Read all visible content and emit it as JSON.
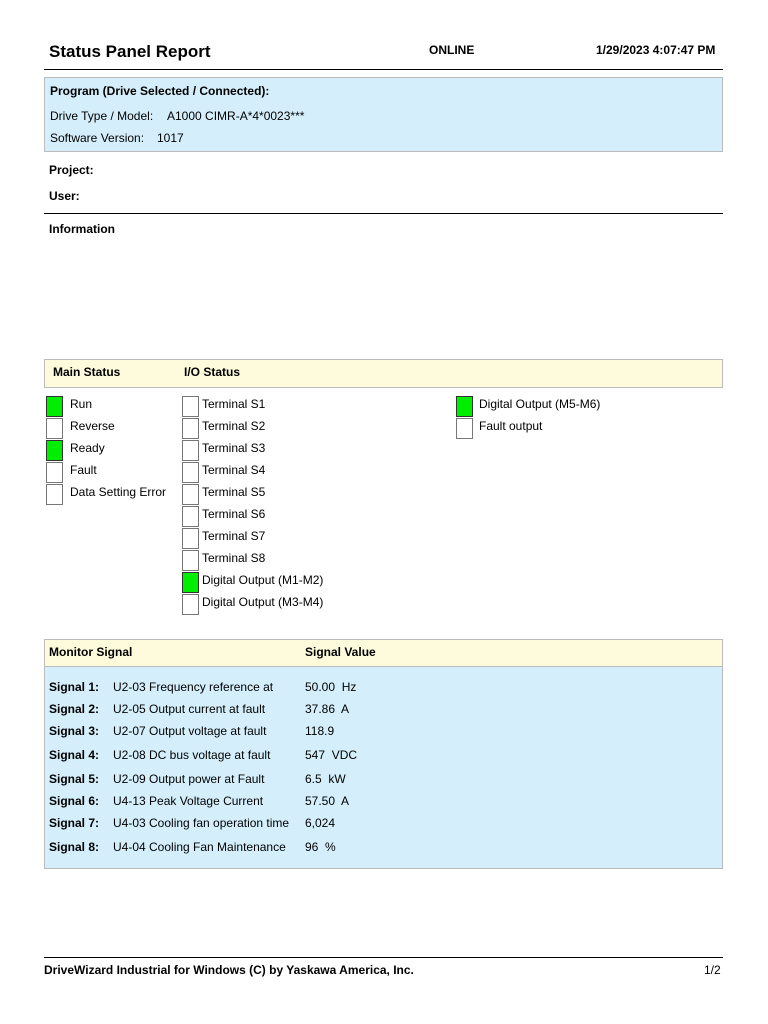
{
  "header": {
    "title": "Status Panel Report",
    "status": "ONLINE",
    "datetime": "1/29/2023 4:07:47 PM"
  },
  "program": {
    "heading": "Program (Drive Selected / Connected):",
    "drive_label": "Drive Type / Model:",
    "drive_value": "A1000 CIMR-A*4*0023***",
    "sw_label": "Software Version:",
    "sw_value": "1017"
  },
  "project_label": "Project:",
  "user_label": "User:",
  "information_label": "Information",
  "status_header": {
    "main": "Main Status",
    "io": "I/O Status"
  },
  "main_status": [
    {
      "label": "Run",
      "on": true
    },
    {
      "label": "Reverse",
      "on": false
    },
    {
      "label": "Ready",
      "on": true
    },
    {
      "label": "Fault",
      "on": false
    },
    {
      "label": "Data Setting Error",
      "on": false
    }
  ],
  "io_status": [
    {
      "label": "Terminal S1",
      "on": false
    },
    {
      "label": "Terminal S2",
      "on": false
    },
    {
      "label": "Terminal S3",
      "on": false
    },
    {
      "label": "Terminal S4",
      "on": false
    },
    {
      "label": "Terminal S5",
      "on": false
    },
    {
      "label": "Terminal S6",
      "on": false
    },
    {
      "label": "Terminal S7",
      "on": false
    },
    {
      "label": "Terminal S8",
      "on": false
    },
    {
      "label": "Digital Output (M1-M2)",
      "on": true
    },
    {
      "label": "Digital Output (M3-M4)",
      "on": false
    }
  ],
  "io_status_2": [
    {
      "label": "Digital Output (M5-M6)",
      "on": true
    },
    {
      "label": "Fault output",
      "on": false
    }
  ],
  "monitor": {
    "col1": "Monitor Signal",
    "col2": "Signal Value",
    "signals": [
      {
        "name": "Signal 1:",
        "desc": "U2-03 Frequency reference at",
        "value": "50.00  Hz"
      },
      {
        "name": "Signal 2:",
        "desc": "U2-05 Output current at fault",
        "value": "37.86  A"
      },
      {
        "name": "Signal 3:",
        "desc": "U2-07 Output voltage at fault",
        "value": "118.9"
      },
      {
        "name": "Signal 4:",
        "desc": "U2-08 DC bus voltage at fault",
        "value": "547  VDC"
      },
      {
        "name": "Signal 5:",
        "desc": "U2-09 Output power at Fault",
        "value": "6.5  kW"
      },
      {
        "name": "Signal 6:",
        "desc": "U4-13 Peak Voltage Current",
        "value": "57.50  A"
      },
      {
        "name": "Signal 7:",
        "desc": "U4-03 Cooling fan operation time",
        "value": "6,024"
      },
      {
        "name": "Signal 8:",
        "desc": "U4-04 Cooling Fan Maintenance",
        "value": "96  %"
      }
    ]
  },
  "footer": {
    "text": "DriveWizard Industrial for Windows (C) by Yaskawa America, Inc.",
    "page": "1/2"
  },
  "colors": {
    "on": "#00ee00",
    "info_bg": "#d4effb",
    "header_bg": "#fefbdc"
  }
}
